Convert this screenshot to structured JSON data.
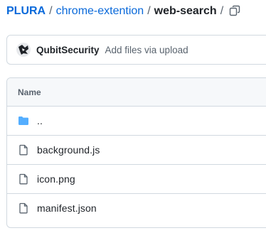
{
  "breadcrumb": {
    "owner": "PLURA",
    "repo": "chrome-extention",
    "current": "web-search",
    "separator": "/",
    "trailing": "/"
  },
  "commit": {
    "author": "QubitSecurity",
    "message": "Add files via upload"
  },
  "table": {
    "header": "Name",
    "rows": [
      {
        "name": "..",
        "icon": "folder-icon"
      },
      {
        "name": "background.js",
        "icon": "file-icon"
      },
      {
        "name": "icon.png",
        "icon": "file-icon"
      },
      {
        "name": "manifest.json",
        "icon": "file-icon"
      }
    ]
  },
  "colors": {
    "link": "#0969da",
    "folder": "#54aeff",
    "border": "#d1d9e0",
    "header_bg": "#f6f8fa",
    "muted": "#59636e"
  }
}
